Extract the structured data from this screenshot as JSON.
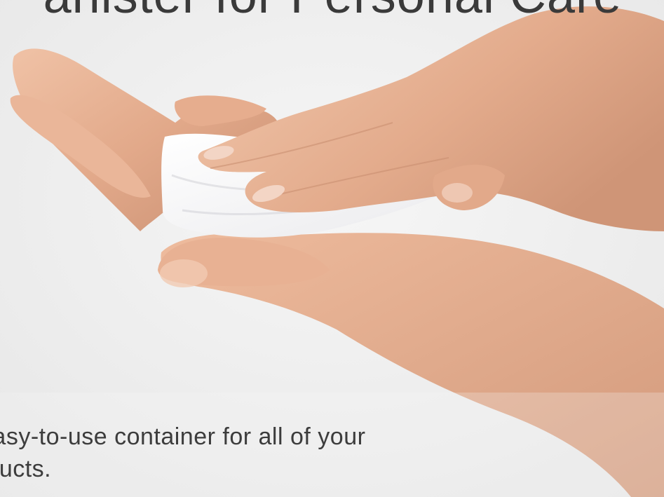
{
  "hero": {
    "headline": "anister for Personal Care",
    "tagline": "easy-to-use container for all of your products.",
    "tagline_line1": "easy-to-use container for all of your",
    "tagline_line2": "oducts."
  }
}
